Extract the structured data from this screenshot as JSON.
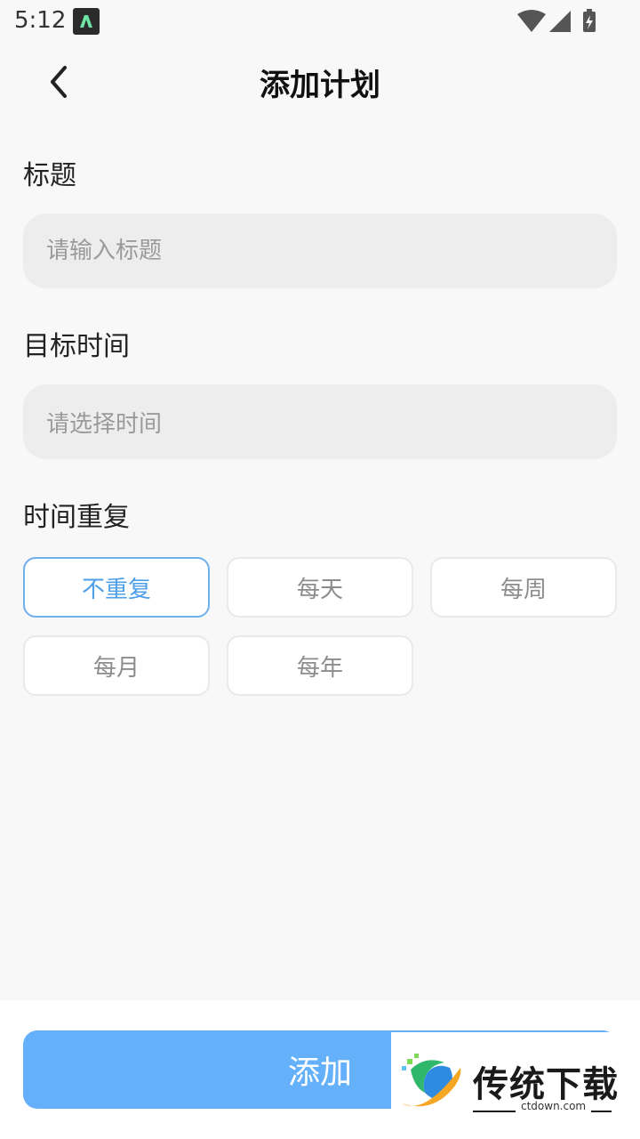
{
  "status_bar": {
    "time": "5:12",
    "app_icon": "app-notification-icon",
    "icons": [
      "wifi-icon",
      "signal-icon",
      "battery-charging-icon"
    ]
  },
  "header": {
    "title": "添加计划",
    "back_icon": "chevron-left-icon"
  },
  "form": {
    "title_label": "标题",
    "title_placeholder": "请输入标题",
    "title_value": "",
    "target_time_label": "目标时间",
    "target_time_placeholder": "请选择时间",
    "repeat_label": "时间重复",
    "repeat_options": [
      {
        "label": "不重复",
        "selected": true
      },
      {
        "label": "每天",
        "selected": false
      },
      {
        "label": "每周",
        "selected": false
      },
      {
        "label": "每月",
        "selected": false
      },
      {
        "label": "每年",
        "selected": false
      }
    ]
  },
  "footer": {
    "add_label": "添加"
  },
  "watermark": {
    "brand": "传统下载",
    "site": "ctdown.com"
  },
  "colors": {
    "accent": "#64b0fa",
    "selected_chip_text": "#4c9fe8",
    "background": "#f8f8f8",
    "field_background": "#ededed"
  }
}
